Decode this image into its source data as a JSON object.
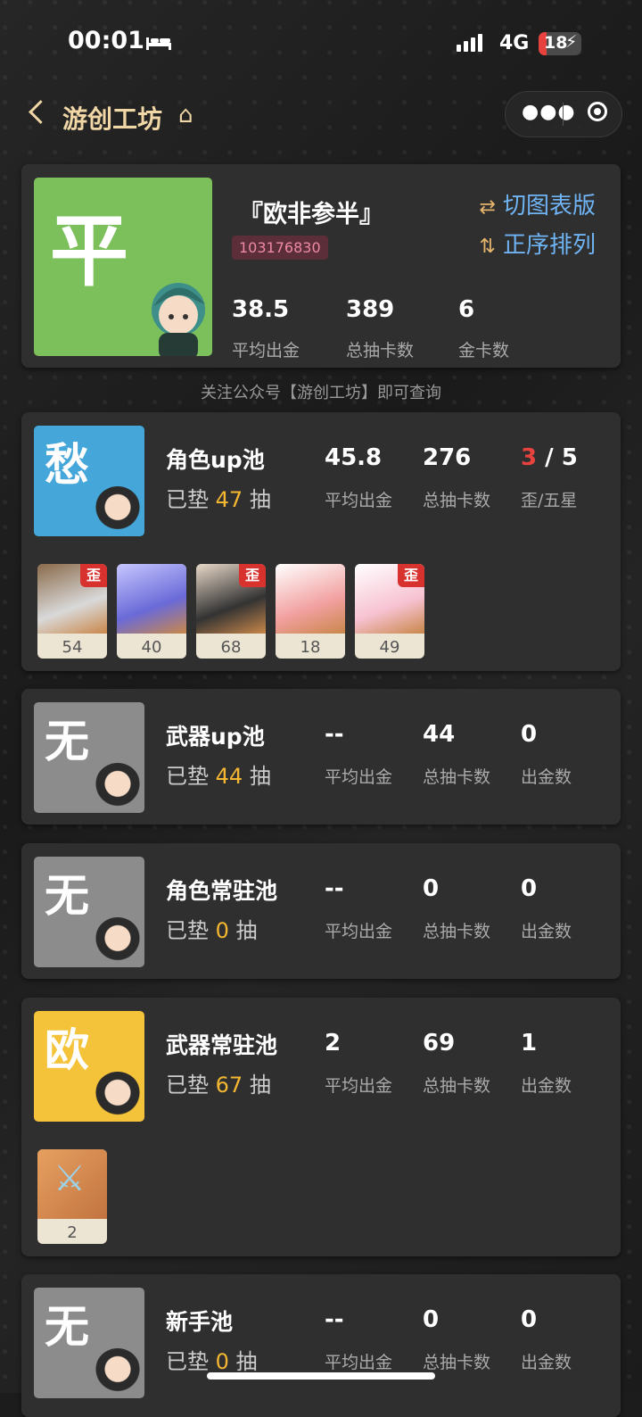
{
  "status_bar": {
    "time": "00:01",
    "network": "4G",
    "battery": "18"
  },
  "nav": {
    "back_label": "<",
    "title": "游创工坊"
  },
  "summary": {
    "grade": "平",
    "title": "『欧非参半』",
    "uid": "103176830",
    "actions": [
      "切图表版",
      "正序排列"
    ],
    "stats": [
      {
        "value": "38.5",
        "label": "平均出金"
      },
      {
        "value": "389",
        "label": "总抽卡数"
      },
      {
        "value": "6",
        "label": "金卡数"
      }
    ],
    "grade_color": "#7cc05c"
  },
  "note": "关注公众号【游创工坊】即可查询",
  "pools": [
    {
      "grade": "愁",
      "grade_color": "#45a6d9",
      "name": "角色up池",
      "pad_prefix": "已垫",
      "pad": "47",
      "pad_suffix": "抽",
      "stats": [
        {
          "value": "45.8",
          "label": "平均出金"
        },
        {
          "value": "276",
          "label": "总抽卡数"
        },
        {
          "value_red": "3",
          "value": " / 5",
          "label": "歪/五星"
        }
      ],
      "items": [
        {
          "count": "54",
          "wai": "歪"
        },
        {
          "count": "40",
          "wai": ""
        },
        {
          "count": "68",
          "wai": "歪"
        },
        {
          "count": "18",
          "wai": ""
        },
        {
          "count": "49",
          "wai": "歪"
        }
      ]
    },
    {
      "grade": "无",
      "grade_color": "#8c8c8c",
      "name": "武器up池",
      "pad_prefix": "已垫",
      "pad": "44",
      "pad_suffix": "抽",
      "stats": [
        {
          "value": "--",
          "label": "平均出金"
        },
        {
          "value": "44",
          "label": "总抽卡数"
        },
        {
          "value": "0",
          "label": "出金数"
        }
      ],
      "items": []
    },
    {
      "grade": "无",
      "grade_color": "#8c8c8c",
      "name": "角色常驻池",
      "pad_prefix": "已垫",
      "pad": "0",
      "pad_suffix": "抽",
      "stats": [
        {
          "value": "--",
          "label": "平均出金"
        },
        {
          "value": "0",
          "label": "总抽卡数"
        },
        {
          "value": "0",
          "label": "出金数"
        }
      ],
      "items": []
    },
    {
      "grade": "欧",
      "grade_color": "#f5c33a",
      "name": "武器常驻池",
      "pad_prefix": "已垫",
      "pad": "67",
      "pad_suffix": "抽",
      "stats": [
        {
          "value": "2",
          "label": "平均出金"
        },
        {
          "value": "69",
          "label": "总抽卡数"
        },
        {
          "value": "1",
          "label": "出金数"
        }
      ],
      "items": [
        {
          "count": "2",
          "wai": ""
        }
      ]
    },
    {
      "grade": "无",
      "grade_color": "#8c8c8c",
      "name": "新手池",
      "pad_prefix": "已垫",
      "pad": "0",
      "pad_suffix": "抽",
      "stats": [
        {
          "value": "--",
          "label": "平均出金"
        },
        {
          "value": "0",
          "label": "总抽卡数"
        },
        {
          "value": "0",
          "label": "出金数"
        }
      ],
      "items": []
    }
  ]
}
